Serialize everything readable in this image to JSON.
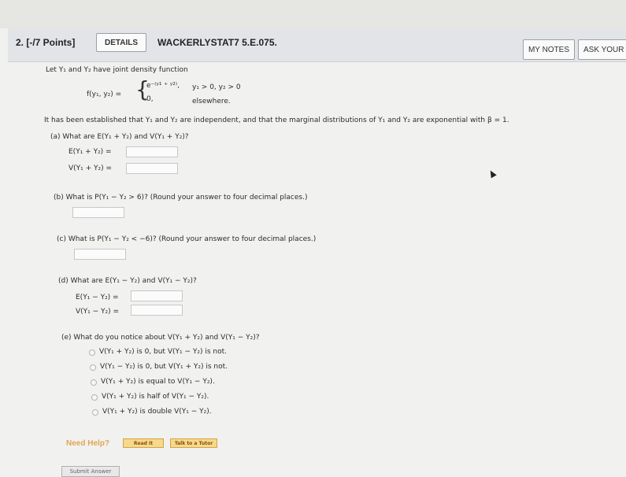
{
  "header": {
    "question_number": "2. [-/7 Points]",
    "details_label": "DETAILS",
    "problem_code": "WACKERLYSTAT7 5.E.075.",
    "my_notes_label": "MY NOTES",
    "ask_your_label": "ASK YOUR T"
  },
  "problem": {
    "intro": "Let Y₁ and Y₂ have joint density function",
    "fn_left": "f(y₁, y₂) =",
    "case1_expr": "e⁻⁽ʸ¹ ⁺ ʸ²⁾,",
    "case1_cond": "y₁ > 0, y₂ > 0",
    "case2_expr": "0,",
    "case2_cond": "elsewhere.",
    "established": "It has been established that Y₁ and Y₂ are independent, and that the marginal distributions of Y₁ and Y₂ are exponential with β = 1."
  },
  "parts": {
    "a": {
      "question": "(a)   What are E(Y₁ + Y₂) and V(Y₁ + Y₂)?",
      "label1": "E(Y₁ + Y₂) =",
      "label2": "V(Y₁ + Y₂) =",
      "value1": "",
      "value2": ""
    },
    "b": {
      "question": "(b)   What is P(Y₁ − Y₂ > 6)? (Round your answer to four decimal places.)",
      "value": ""
    },
    "c": {
      "question": "(c)   What is P(Y₁ − Y₂ < −6)? (Round your answer to four decimal places.)",
      "value": ""
    },
    "d": {
      "question": "(d)   What are E(Y₁ − Y₂) and V(Y₁ − Y₂)?",
      "label1": "E(Y₁ − Y₂) =",
      "label2": "V(Y₁ − Y₂) =",
      "value1": "",
      "value2": ""
    },
    "e": {
      "question": "(e)   What do you notice about V(Y₁ + Y₂) and V(Y₁ − Y₂)?",
      "options": [
        "V(Y₁ + Y₂) is 0, but V(Y₁ − Y₂) is not.",
        "V(Y₁ − Y₂) is 0, but V(Y₁ + Y₂) is not.",
        "V(Y₁ + Y₂) is equal to V(Y₁ − Y₂).",
        "V(Y₁ + Y₂) is half of V(Y₁ − Y₂).",
        "V(Y₁ + Y₂) is double V(Y₁ − Y₂)."
      ]
    }
  },
  "help": {
    "need_help": "Need Help?",
    "read_it": "Read It",
    "talk_tutor": "Talk to a Tutor"
  },
  "submit_label": "Submit Answer"
}
